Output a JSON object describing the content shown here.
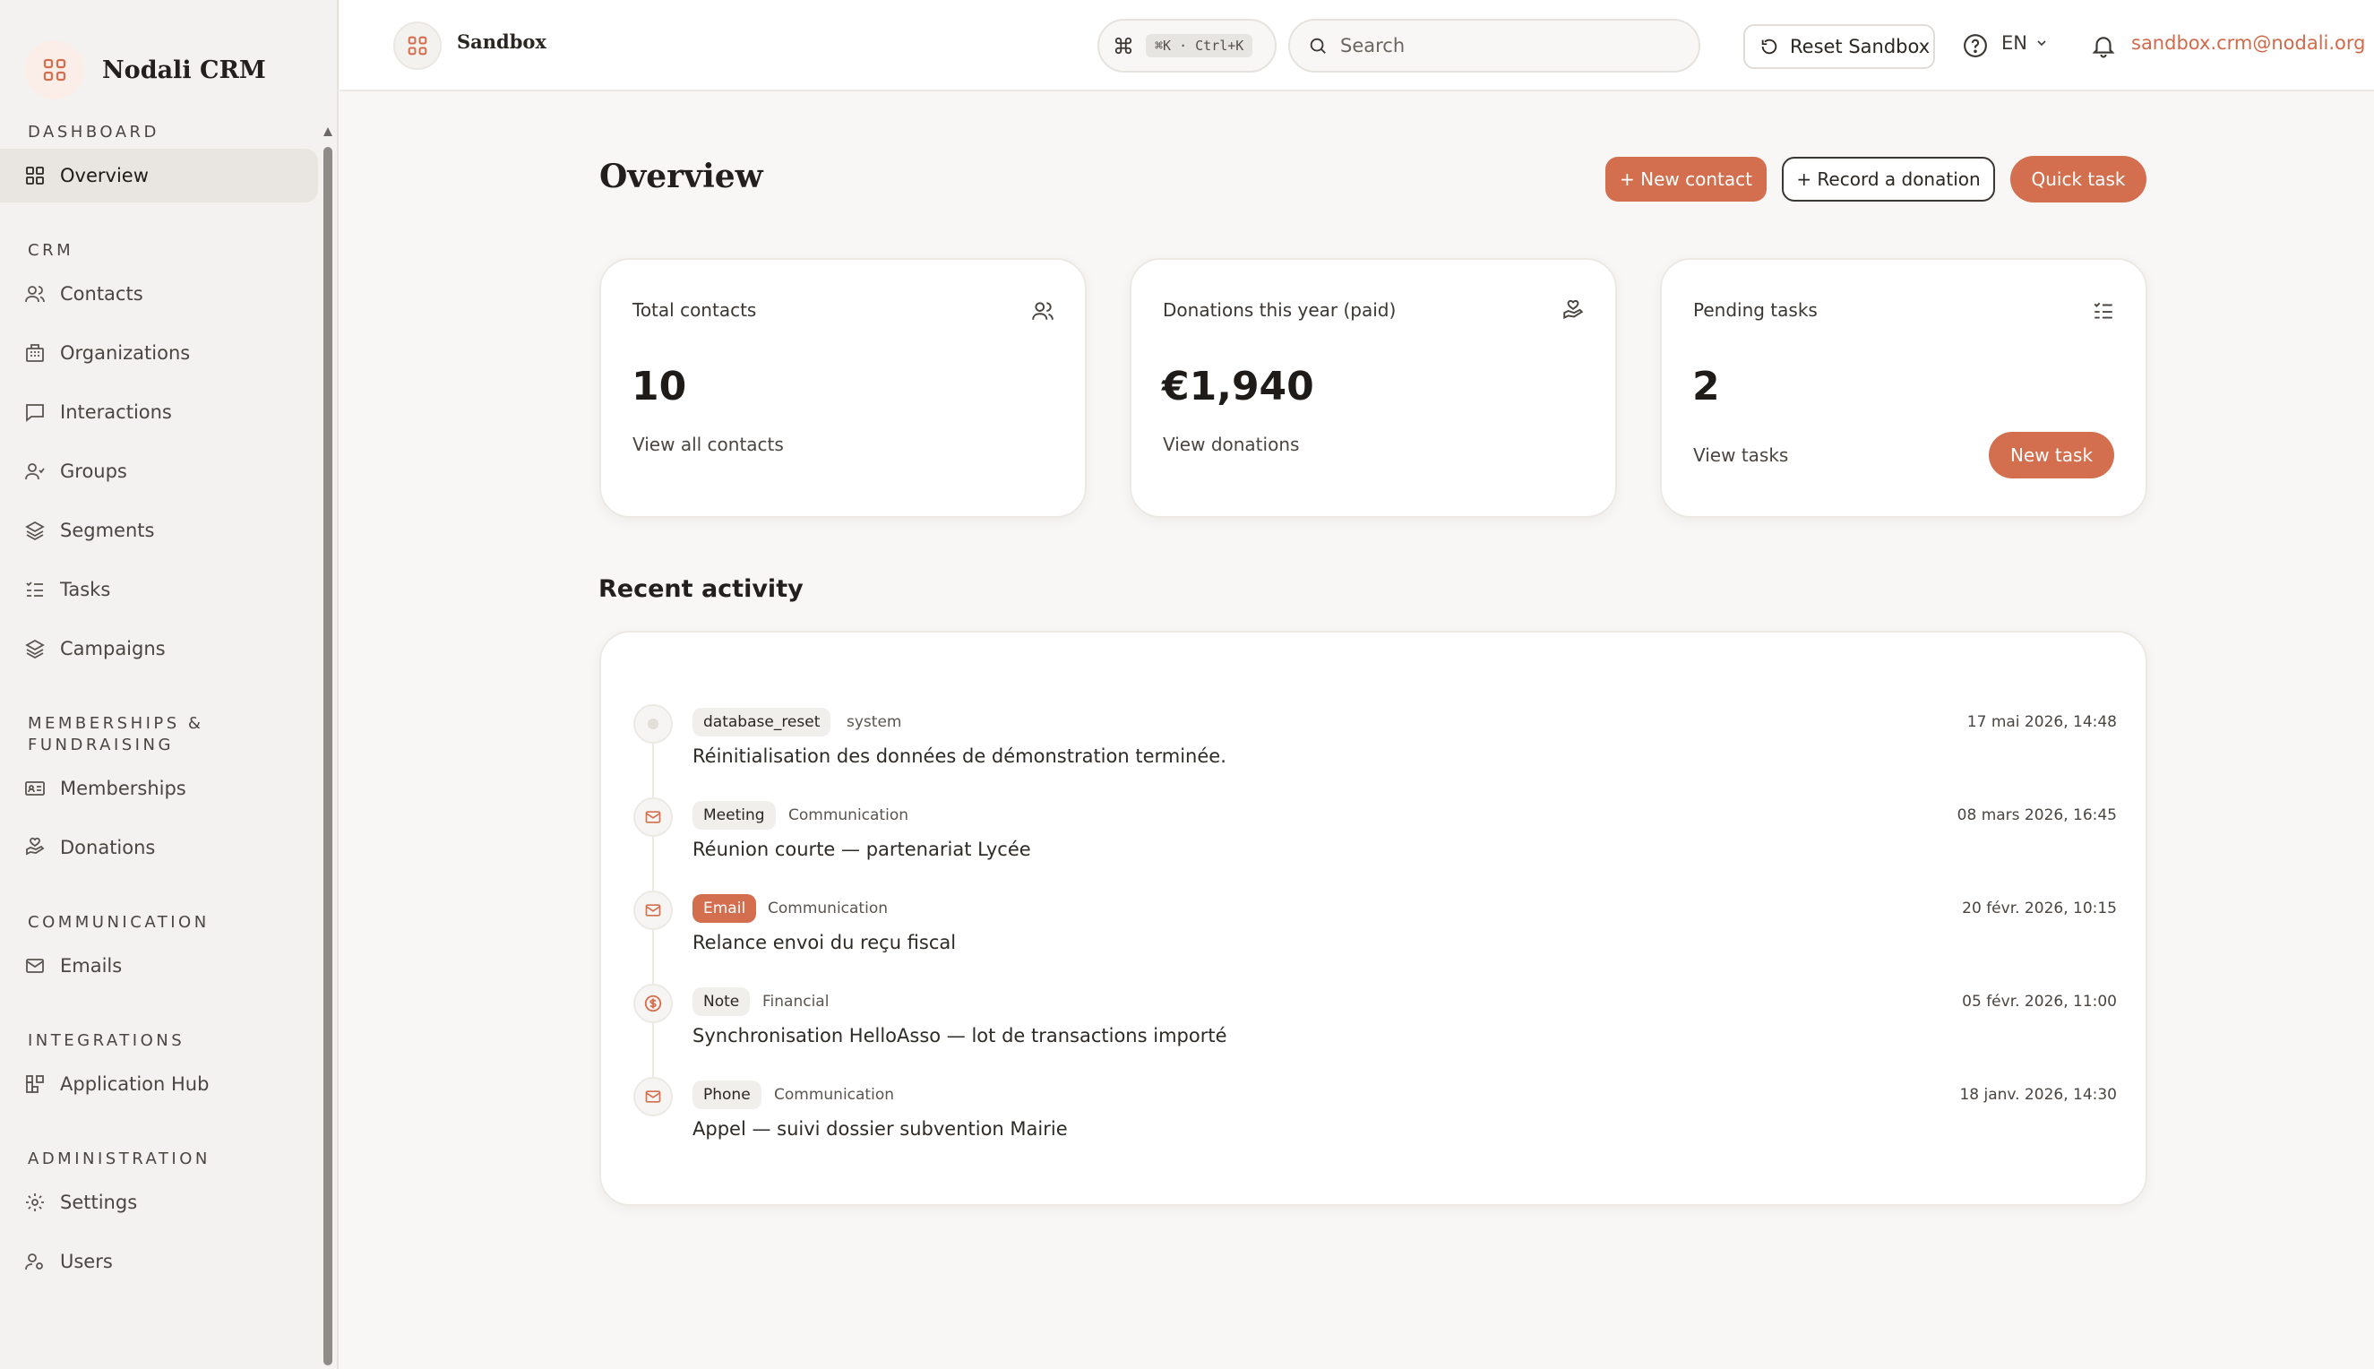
{
  "app": {
    "name": "Nodali CRM",
    "workspace": "Sandbox",
    "accent_color": "#d36f4e"
  },
  "sidebar": {
    "sections": [
      {
        "label": "DASHBOARD",
        "items": [
          {
            "label": "Overview",
            "icon": "grid-icon",
            "active": true
          }
        ]
      },
      {
        "label": "CRM",
        "items": [
          {
            "label": "Contacts",
            "icon": "users-icon"
          },
          {
            "label": "Organizations",
            "icon": "building-icon"
          },
          {
            "label": "Interactions",
            "icon": "chat-icon"
          },
          {
            "label": "Groups",
            "icon": "user-group-icon"
          },
          {
            "label": "Segments",
            "icon": "layers-icon"
          },
          {
            "label": "Tasks",
            "icon": "checklist-icon"
          },
          {
            "label": "Campaigns",
            "icon": "layers-icon"
          }
        ]
      },
      {
        "label": "MEMBERSHIPS & FUNDRAISING",
        "items": [
          {
            "label": "Memberships",
            "icon": "id-card-icon"
          },
          {
            "label": "Donations",
            "icon": "hand-heart-icon"
          }
        ]
      },
      {
        "label": "COMMUNICATION",
        "items": [
          {
            "label": "Emails",
            "icon": "mail-icon"
          }
        ]
      },
      {
        "label": "INTEGRATIONS",
        "items": [
          {
            "label": "Application Hub",
            "icon": "apps-icon"
          }
        ]
      },
      {
        "label": "ADMINISTRATION",
        "items": [
          {
            "label": "Settings",
            "icon": "gear-icon"
          },
          {
            "label": "Users",
            "icon": "user-cog-icon"
          }
        ]
      }
    ]
  },
  "topbar": {
    "shortcut": "⌘K · Ctrl+K",
    "search_placeholder": "Search",
    "reset_label": "Reset Sandbox",
    "language": "EN",
    "user_email": "sandbox.crm@nodali.org"
  },
  "page": {
    "title": "Overview",
    "actions": {
      "new_contact": "+ New contact",
      "record_donation": "+ Record a donation",
      "quick_task": "Quick task"
    }
  },
  "stats": [
    {
      "label": "Total contacts",
      "value": "10",
      "link": "View all contacts",
      "icon": "users-icon"
    },
    {
      "label": "Donations this year (paid)",
      "value": "€1,940",
      "link": "View donations",
      "icon": "hand-heart-icon"
    },
    {
      "label": "Pending tasks",
      "value": "2",
      "link": "View tasks",
      "icon": "checklist-icon",
      "action": "New task"
    }
  ],
  "activity": {
    "title": "Recent activity",
    "items": [
      {
        "tag": "database_reset",
        "category": "system",
        "date": "17 mai 2026, 14:48",
        "description": "Réinitialisation des données de démonstration terminée.",
        "icon": "dot-icon"
      },
      {
        "tag": "Meeting",
        "category": "Communication",
        "date": "08 mars 2026, 16:45",
        "description": "Réunion courte — partenariat Lycée",
        "icon": "mail-icon"
      },
      {
        "tag": "Email",
        "category": "Communication",
        "date": "20 févr. 2026, 10:15",
        "description": "Relance envoi du reçu fiscal",
        "icon": "mail-icon",
        "highlight": true
      },
      {
        "tag": "Note",
        "category": "Financial",
        "date": "05 févr. 2026, 11:00",
        "description": "Synchronisation HelloAsso — lot de transactions importé",
        "icon": "dollar-icon"
      },
      {
        "tag": "Phone",
        "category": "Communication",
        "date": "18 janv. 2026, 14:30",
        "description": "Appel — suivi dossier subvention Mairie",
        "icon": "mail-icon"
      }
    ]
  }
}
